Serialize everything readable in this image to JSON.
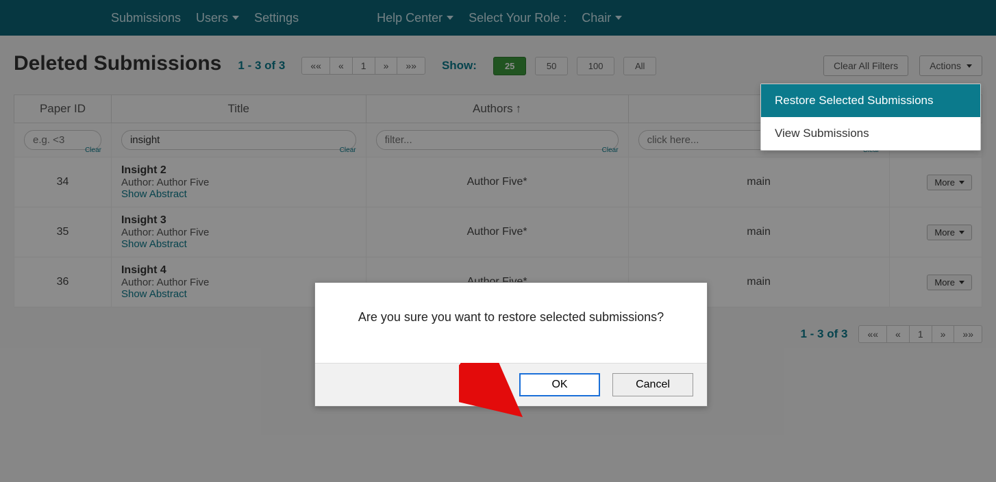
{
  "nav": {
    "submissions": "Submissions",
    "users": "Users",
    "settings": "Settings",
    "help_center": "Help Center",
    "select_role_label": "Select Your Role :",
    "role": "Chair"
  },
  "page": {
    "title": "Deleted Submissions",
    "range": "1 - 3 of 3",
    "show_label": "Show:",
    "clear_all_filters": "Clear All Filters",
    "actions_label": "Actions"
  },
  "pager": {
    "first": "««",
    "prev": "«",
    "page": "1",
    "next": "»",
    "last": "»»"
  },
  "page_sizes": {
    "s25": "25",
    "s50": "50",
    "s100": "100",
    "all": "All"
  },
  "actions_menu": {
    "restore": "Restore Selected Submissions",
    "view": "View Submissions"
  },
  "columns": {
    "paper_id": "Paper ID",
    "title": "Title",
    "authors": "Authors",
    "track": ""
  },
  "filters": {
    "id_placeholder": "e.g. <3",
    "title_value": "insight",
    "authors_placeholder": "filter...",
    "track_placeholder": "click here...",
    "clear": "Clear"
  },
  "rows": [
    {
      "id": "34",
      "title": "Insight 2",
      "author_label": "Author:",
      "author_name": "Author Five",
      "show_abstract": "Show Abstract",
      "authors_col": "Author Five*",
      "track": "main",
      "more": "More"
    },
    {
      "id": "35",
      "title": "Insight 3",
      "author_label": "Author:",
      "author_name": "Author Five",
      "show_abstract": "Show Abstract",
      "authors_col": "Author Five*",
      "track": "main",
      "more": "More"
    },
    {
      "id": "36",
      "title": "Insight 4",
      "author_label": "Author:",
      "author_name": "Author Five",
      "show_abstract": "Show Abstract",
      "authors_col": "Author Five*",
      "track": "main",
      "more": "More"
    }
  ],
  "footer": {
    "range": "1 - 3 of 3"
  },
  "modal": {
    "message": "Are you sure you want to restore selected submissions?",
    "ok": "OK",
    "cancel": "Cancel"
  }
}
